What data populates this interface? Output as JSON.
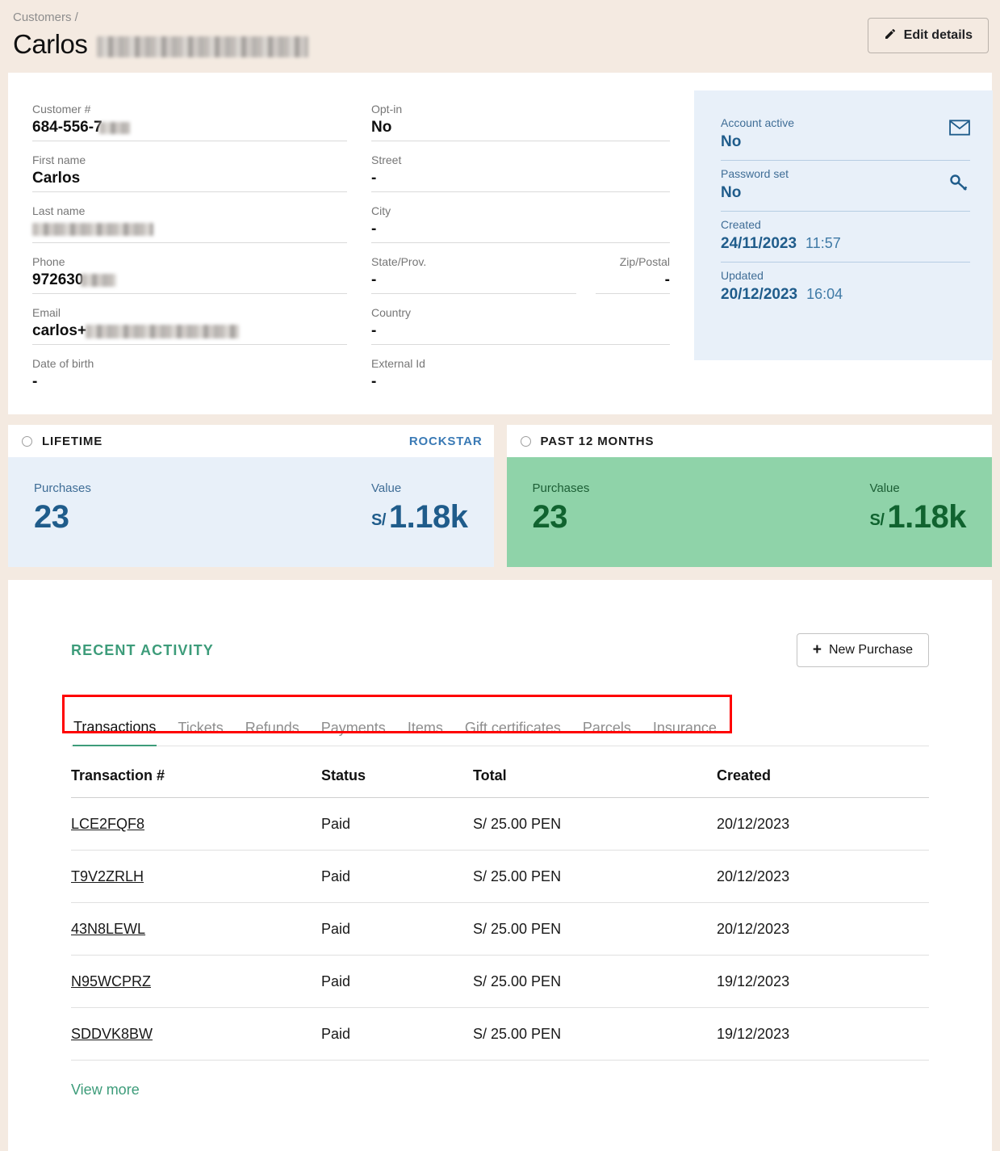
{
  "header": {
    "breadcrumb": "Customers /",
    "title_first": "Carlos",
    "edit_button": "Edit details",
    "edit_icon": "pencil-icon"
  },
  "details": {
    "left_fields": [
      {
        "label": "Customer #",
        "value": "684-556-7",
        "redacted": true
      },
      {
        "label": "First name",
        "value": "Carlos",
        "redacted": false
      },
      {
        "label": "Last name",
        "value": "",
        "redacted": true
      },
      {
        "label": "Phone",
        "value": "972630",
        "redacted": true
      },
      {
        "label": "Email",
        "value": "carlos+",
        "redacted": true
      },
      {
        "label": "Date of birth",
        "value": "-",
        "redacted": false
      }
    ],
    "middle_fields": [
      {
        "label": "Opt-in",
        "value": "No"
      },
      {
        "label": "Street",
        "value": "-"
      },
      {
        "label": "City",
        "value": "-"
      },
      {
        "label": "State/Prov.",
        "value": "-"
      },
      {
        "label": "Zip/Postal",
        "value": "-"
      },
      {
        "label": "Country",
        "value": "-"
      },
      {
        "label": "External Id",
        "value": "-"
      }
    ],
    "account_panel": {
      "account_active_label": "Account active",
      "account_active_value": "No",
      "account_active_icon": "envelope-icon",
      "password_set_label": "Password set",
      "password_set_value": "No",
      "password_set_icon": "key-icon",
      "created_label": "Created",
      "created_date": "24/11/2023",
      "created_time": "11:57",
      "updated_label": "Updated",
      "updated_date": "20/12/2023",
      "updated_time": "16:04"
    }
  },
  "stats": {
    "lifetime": {
      "title": "LIFETIME",
      "badge": "ROCKSTAR",
      "purchases_label": "Purchases",
      "purchases_value": "23",
      "value_label": "Value",
      "currency": "S/",
      "value_amount": "1.18k"
    },
    "past12": {
      "title": "PAST 12 MONTHS",
      "badge": "",
      "purchases_label": "Purchases",
      "purchases_value": "23",
      "value_label": "Value",
      "currency": "S/",
      "value_amount": "1.18k"
    }
  },
  "activity": {
    "title": "RECENT ACTIVITY",
    "new_purchase_button": "New Purchase",
    "new_purchase_icon": "plus-icon",
    "tabs": [
      {
        "label": "Transactions",
        "active": true
      },
      {
        "label": "Tickets",
        "active": false
      },
      {
        "label": "Refunds",
        "active": false
      },
      {
        "label": "Payments",
        "active": false
      },
      {
        "label": "Items",
        "active": false
      },
      {
        "label": "Gift certificates",
        "active": false
      },
      {
        "label": "Parcels",
        "active": false
      },
      {
        "label": "Insurance",
        "active": false
      }
    ],
    "table": {
      "columns": [
        "Transaction #",
        "Status",
        "Total",
        "Created"
      ],
      "rows": [
        {
          "id": "LCE2FQF8",
          "status": "Paid",
          "total": "S/ 25.00 PEN",
          "created": "20/12/2023"
        },
        {
          "id": "T9V2ZRLH",
          "status": "Paid",
          "total": "S/ 25.00 PEN",
          "created": "20/12/2023"
        },
        {
          "id": "43N8LEWL",
          "status": "Paid",
          "total": "S/ 25.00 PEN",
          "created": "20/12/2023"
        },
        {
          "id": "N95WCPRZ",
          "status": "Paid",
          "total": "S/ 25.00 PEN",
          "created": "19/12/2023"
        },
        {
          "id": "SDDVK8BW",
          "status": "Paid",
          "total": "S/ 25.00 PEN",
          "created": "19/12/2023"
        }
      ]
    },
    "view_more": "View more"
  },
  "colors": {
    "page_background": "#f4eae1",
    "accent_green": "#3d9c7a",
    "accent_blue": "#1f5c8b",
    "badge_blue": "#3a7ab5",
    "panel_blue": "#e8f0f9",
    "panel_green": "#8fd3a9",
    "highlight_red": "#ff0000"
  }
}
